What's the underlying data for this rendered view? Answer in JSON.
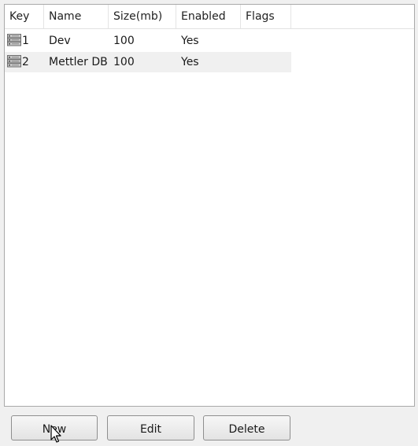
{
  "columns": {
    "key": "Key",
    "name": "Name",
    "size": "Size(mb)",
    "enabled": "Enabled",
    "flags": "Flags"
  },
  "rows": [
    {
      "key": "1",
      "name": "Dev",
      "size": "100",
      "enabled": "Yes",
      "flags": "",
      "icon": "database-icon"
    },
    {
      "key": "2",
      "name": "Mettler DB",
      "size": "100",
      "enabled": "Yes",
      "flags": "",
      "icon": "database-icon"
    }
  ],
  "buttons": {
    "new": "New",
    "edit": "Edit",
    "delete": "Delete"
  },
  "cursor_icon": "mouse-pointer-icon"
}
